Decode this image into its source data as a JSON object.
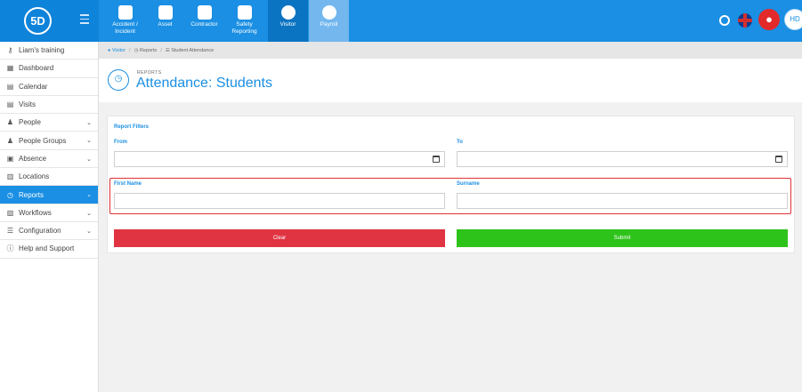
{
  "brand": {
    "logo": "5D"
  },
  "modules": [
    {
      "label1": "Accident /",
      "label2": "Incident"
    },
    {
      "label1": "Asset",
      "label2": ""
    },
    {
      "label1": "Contractor",
      "label2": ""
    },
    {
      "label1": "Safety",
      "label2": "Reporting"
    },
    {
      "label1": "Visitor",
      "label2": ""
    },
    {
      "label1": "Payroll",
      "label2": ""
    }
  ],
  "user": {
    "initials": "HD"
  },
  "sidebar": {
    "items": [
      {
        "label": "Liam's training",
        "icon": "key-icon"
      },
      {
        "label": "Dashboard",
        "icon": "grid-icon"
      },
      {
        "label": "Calendar",
        "icon": "calendar-icon"
      },
      {
        "label": "Visits",
        "icon": "calendar-check-icon"
      },
      {
        "label": "People",
        "icon": "people-icon"
      },
      {
        "label": "People Groups",
        "icon": "people-group-icon"
      },
      {
        "label": "Absence",
        "icon": "absence-icon"
      },
      {
        "label": "Locations",
        "icon": "building-icon"
      },
      {
        "label": "Reports",
        "icon": "clock-icon"
      },
      {
        "label": "Workflows",
        "icon": "workflow-icon"
      },
      {
        "label": "Configuration",
        "icon": "configuration-icon"
      },
      {
        "label": "Help and Support",
        "icon": "help-icon"
      }
    ]
  },
  "breadcrumb": {
    "b1": "Visitor",
    "b2": "Reports",
    "b3": "Student Attendance"
  },
  "header": {
    "kicker": "REPORTS",
    "title": "Attendance: Students"
  },
  "filters": {
    "heading": "Report Filters",
    "from_label": "From",
    "to_label": "To",
    "first_name_label": "First Name",
    "surname_label": "Surname",
    "from_value": "",
    "to_value": "",
    "first_name_value": "",
    "surname_value": ""
  },
  "buttons": {
    "clear": "Clear",
    "submit": "Submit"
  },
  "colors": {
    "primary": "#1a8fe3",
    "clear": "#e03443",
    "submit": "#2ec31a",
    "highlight": "#e03131"
  }
}
